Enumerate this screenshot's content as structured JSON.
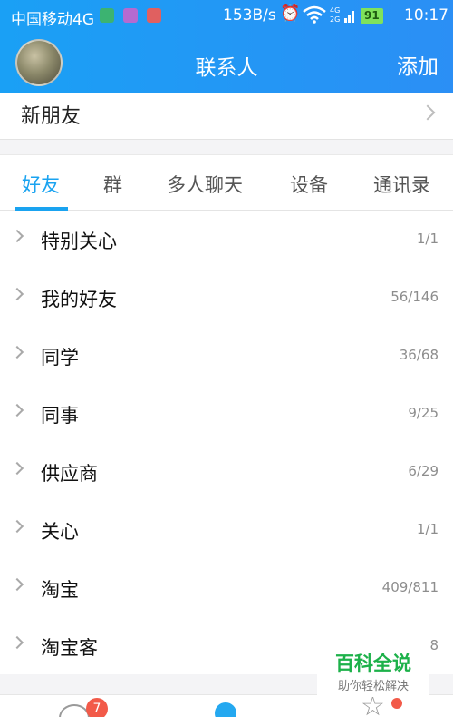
{
  "status_bar": {
    "carrier": "中国移动4G",
    "speed": "153B/s",
    "battery": "91",
    "time": "10:17",
    "signal_label": "4G 2G"
  },
  "header": {
    "title": "联系人",
    "add_label": "添加"
  },
  "new_friends": {
    "label": "新朋友"
  },
  "tabs": [
    {
      "label": "好友",
      "active": true
    },
    {
      "label": "群"
    },
    {
      "label": "多人聊天"
    },
    {
      "label": "设备"
    },
    {
      "label": "通讯录"
    }
  ],
  "groups": [
    {
      "name": "特别关心",
      "count": "1/1"
    },
    {
      "name": "我的好友",
      "count": "56/146"
    },
    {
      "name": "同学",
      "count": "36/68"
    },
    {
      "name": "同事",
      "count": "9/25"
    },
    {
      "name": "供应商",
      "count": "6/29"
    },
    {
      "name": "关心",
      "count": "1/1"
    },
    {
      "name": "淘宝",
      "count": "409/811"
    },
    {
      "name": "淘宝客",
      "count": "8"
    }
  ],
  "bottom_nav": {
    "messages_badge": "7"
  },
  "watermark": {
    "main": "百科全说",
    "sub": "助你轻松解决"
  },
  "colors": {
    "accent": "#1aa3f0",
    "badge": "#f25a49",
    "watermark": "#1db14a"
  }
}
